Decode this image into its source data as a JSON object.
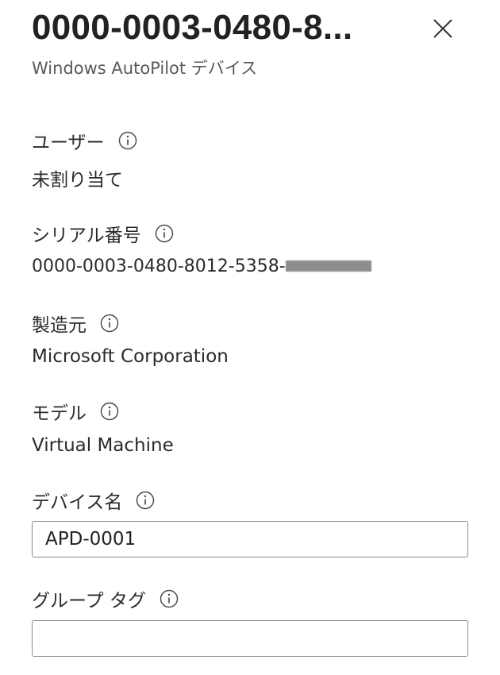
{
  "header": {
    "title": "0000-0003-0480-8...",
    "subtitle": "Windows AutoPilot デバイス"
  },
  "fields": {
    "user": {
      "label": "ユーザー",
      "value": "未割り当て"
    },
    "serial": {
      "label": "シリアル番号",
      "value": "0000-0003-0480-8012-5358-"
    },
    "manufacturer": {
      "label": "製造元",
      "value": "Microsoft Corporation"
    },
    "model": {
      "label": "モデル",
      "value": "Virtual Machine"
    },
    "device_name": {
      "label": "デバイス名",
      "value": "APD-0001"
    },
    "group_tag": {
      "label": "グループ タグ",
      "value": ""
    }
  },
  "icons": {
    "close": "close-icon",
    "info": "info-icon"
  },
  "colors": {
    "text": "#2b2b2b",
    "subtext": "#5a5a5a",
    "border": "#8a8a8a",
    "redaction": "#8c8c8c"
  }
}
